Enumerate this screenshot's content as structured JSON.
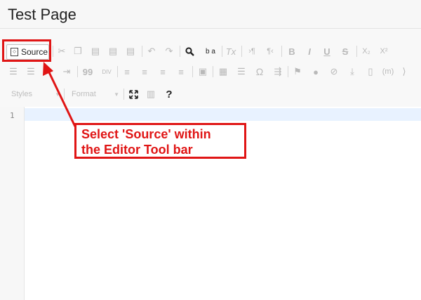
{
  "page": {
    "title": "Test Page"
  },
  "toolbar": {
    "source_label": "Source",
    "styles_label": "Styles",
    "format_label": "Format",
    "help_label": "?",
    "omega_label": "Ω",
    "quote_label": "99",
    "div_label": "DIV",
    "bold_label": "B",
    "italic_label": "I",
    "underline_label": "U",
    "strike_label": "S",
    "subscript_label": "X₂",
    "superscript_label": "X²",
    "clear_format_label": "Tx",
    "ltr_label": "›¶",
    "rtl_label": "¶‹",
    "find_label": "b a",
    "iframe_label": "(m)"
  },
  "editor": {
    "line_numbers": [
      "1"
    ]
  },
  "annotation": {
    "line1": "Select 'Source' within",
    "line2": "the Editor Tool bar",
    "color": "#e01515"
  }
}
